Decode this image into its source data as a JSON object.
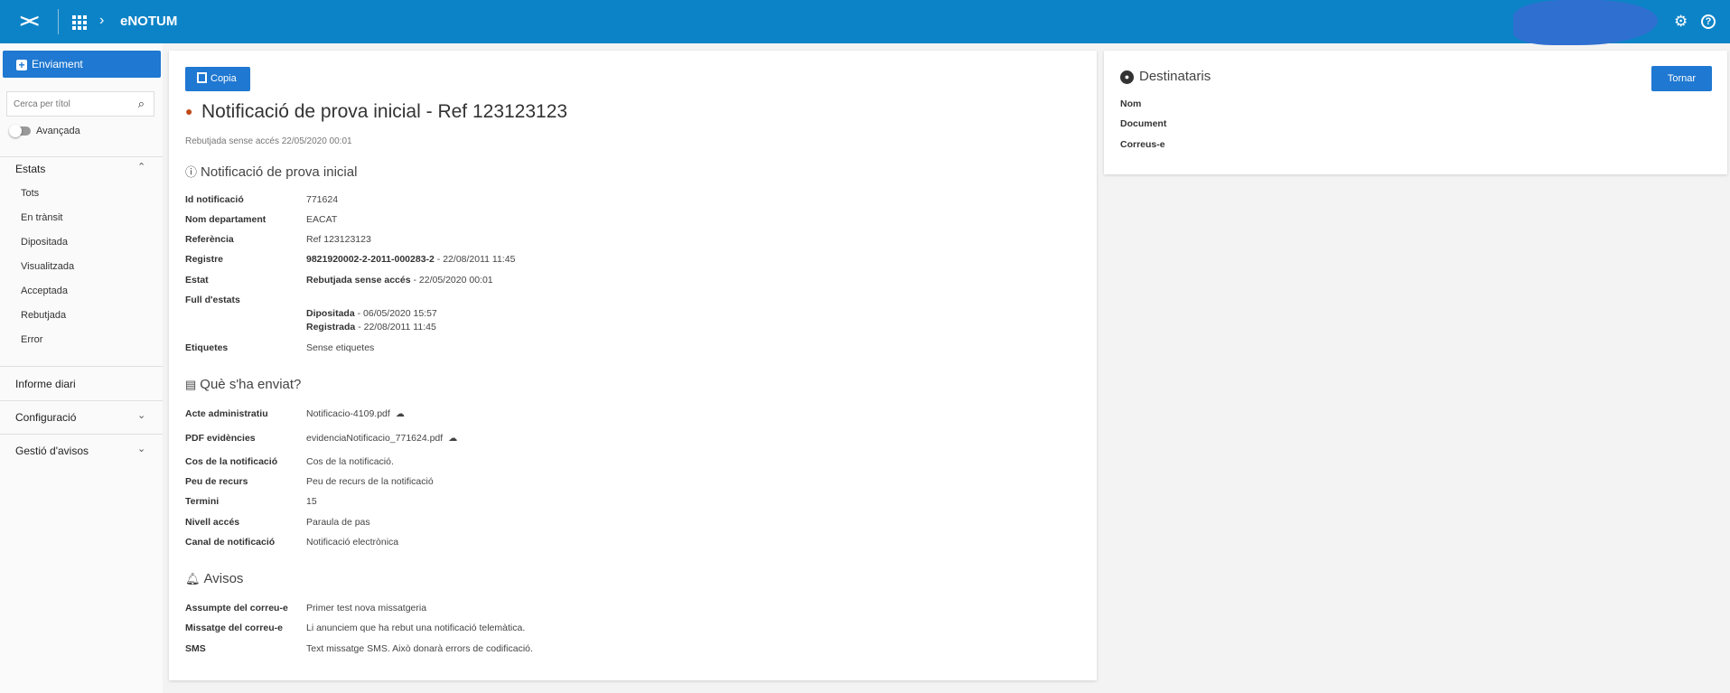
{
  "topbar": {
    "logo": "><",
    "app_name": "eNOTUM",
    "breadcrumb_sep": "›",
    "settings_icon": "gear-icon",
    "help_icon": "help-icon",
    "help_glyph": "?"
  },
  "sidebar": {
    "enviament_button": "Enviament",
    "search_placeholder": "Cerca per títol",
    "advanced_label": "Avançada",
    "estats_title": "Estats",
    "estats_items": [
      "Tots",
      "En trànsit",
      "Dipositada",
      "Visualitzada",
      "Acceptada",
      "Rebutjada",
      "Error"
    ],
    "informe_diari": "Informe diari",
    "configuracio": "Configuració",
    "gestio_avisos": "Gestió d'avisos"
  },
  "main": {
    "copy_button": "Copia",
    "title": "Notificació de prova inicial - Ref 123123123",
    "subtitle": "Rebutjada sense accés 22/05/2020 00:01",
    "section_info": {
      "heading": "Notificació de prova inicial",
      "id_label": "Id notificació",
      "id_value": "771624",
      "dept_label": "Nom departament",
      "dept_value": "EACAT",
      "ref_label": "Referència",
      "ref_value": "Ref 123123123",
      "registre_label": "Registre",
      "registre_number": "9821920002-2-2011-000283-2",
      "registre_date": " - 22/08/2011 11:45",
      "estat_label": "Estat",
      "estat_value": "Rebutjada sense accés",
      "estat_date": " - 22/05/2020 00:01",
      "full_label": "Full d'estats",
      "full_1_state": "Dipositada",
      "full_1_date": " - 06/05/2020 15:57",
      "full_2_state": "Registrada",
      "full_2_date": " - 22/08/2011 11:45",
      "etiquetes_label": "Etiquetes",
      "etiquetes_value": "Sense etiquetes"
    },
    "section_sent": {
      "heading": "Què s'ha enviat?",
      "acte_label": "Acte administratiu",
      "acte_value": "Notificacio-4109.pdf",
      "pdf_label": "PDF evidències",
      "pdf_value": "evidenciaNotificacio_771624.pdf",
      "cos_label": "Cos de la notificació",
      "cos_value": "Cos de la notificació.",
      "peu_label": "Peu de recurs",
      "peu_value": "Peu de recurs de la notificació",
      "termini_label": "Termini",
      "termini_value": "15",
      "nivell_label": "Nivell accés",
      "nivell_value": "Paraula de pas",
      "canal_label": "Canal de notificació",
      "canal_value": "Notificació electrònica"
    },
    "section_avisos": {
      "heading": "Avisos",
      "assumpte_label": "Assumpte del correu-e",
      "assumpte_value": "Primer test nova missatgeria",
      "missatge_label": "Missatge del correu-e",
      "missatge_value": "Li anunciem que ha rebut una notificació telemàtica.",
      "sms_label": "SMS",
      "sms_value": "Text missatge SMS. Això donarà errors de codificació."
    }
  },
  "recipients": {
    "heading": "Destinataris",
    "back_button": "Tornar",
    "nom_label": "Nom",
    "document_label": "Document",
    "email_label": "Correus-e"
  },
  "colors": {
    "topbar": "#0d83c7",
    "primary_button": "#1f78d1"
  }
}
